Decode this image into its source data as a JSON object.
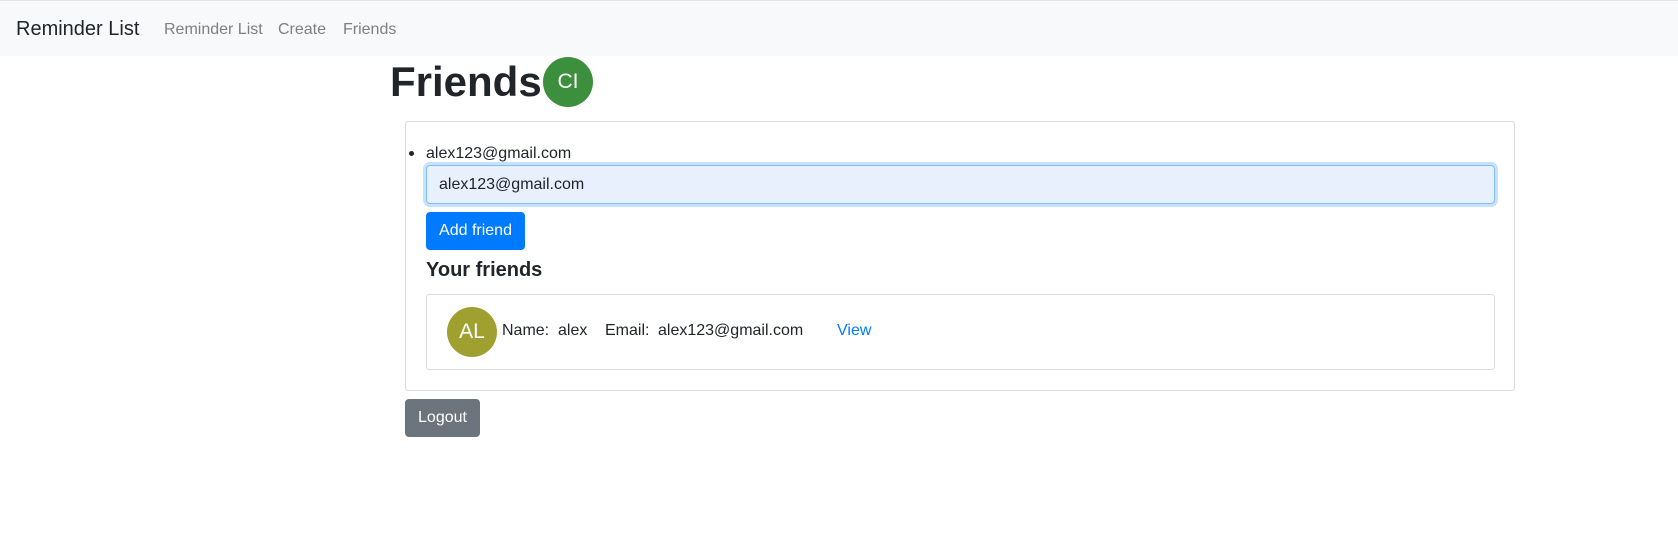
{
  "navbar": {
    "brand": "Reminder List",
    "links": [
      {
        "label": "Reminder List"
      },
      {
        "label": "Create"
      },
      {
        "label": "Friends"
      }
    ]
  },
  "page": {
    "title": "Friends",
    "user_avatar": {
      "initials": "CI",
      "color": "#3c8f3c"
    }
  },
  "add_friend": {
    "list_items": [
      "alex123@gmail.com"
    ],
    "input_value": "alex123@gmail.com",
    "button_label": "Add friend"
  },
  "friends_section": {
    "heading": "Your friends",
    "friends": [
      {
        "initials": "AL",
        "avatar_color": "#9fa030",
        "name_label": "Name:",
        "name": "alex",
        "email_label": "Email:",
        "email": "alex123@gmail.com",
        "view_label": "View"
      }
    ]
  },
  "logout_label": "Logout",
  "colors": {
    "primary": "#007bff",
    "secondary": "#6c757d",
    "navbar_bg": "#f8f9fa"
  }
}
